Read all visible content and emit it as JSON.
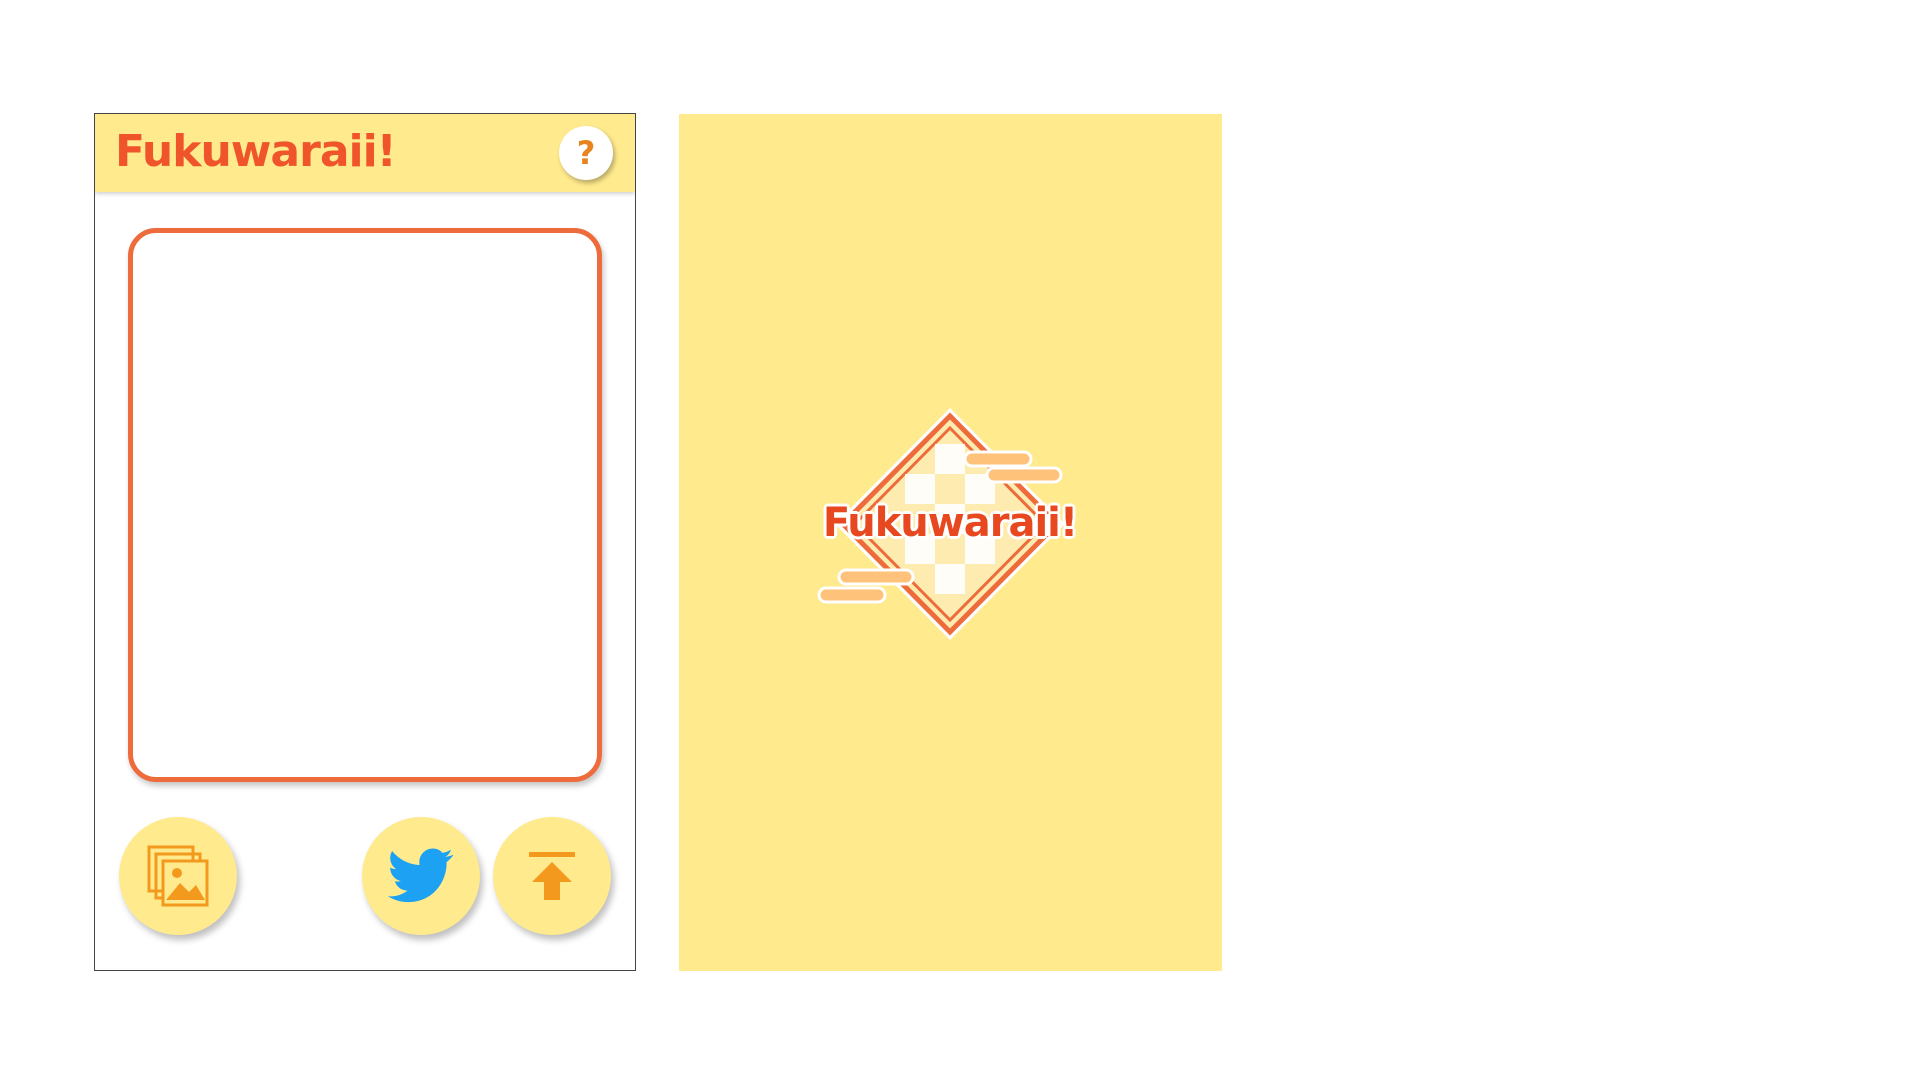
{
  "editor_screen": {
    "header": {
      "app_title": "Fukuwaraii!",
      "help_label": "?"
    },
    "actions": [
      {
        "name": "gallery",
        "icon": "image-gallery-icon"
      },
      {
        "name": "twitter",
        "icon": "twitter-bird-icon"
      },
      {
        "name": "upload",
        "icon": "upload-arrow-icon"
      }
    ]
  },
  "splash_screen": {
    "logo_text": "Fukuwaraii!"
  },
  "colors": {
    "header_bg": "#FFEA8D",
    "accent_orange": "#F0542A",
    "frame_orange": "#EE6B3C",
    "icon_orange": "#F39A1E",
    "twitter_blue": "#1DA1F2",
    "splash_bg": "#FFEA8D"
  }
}
